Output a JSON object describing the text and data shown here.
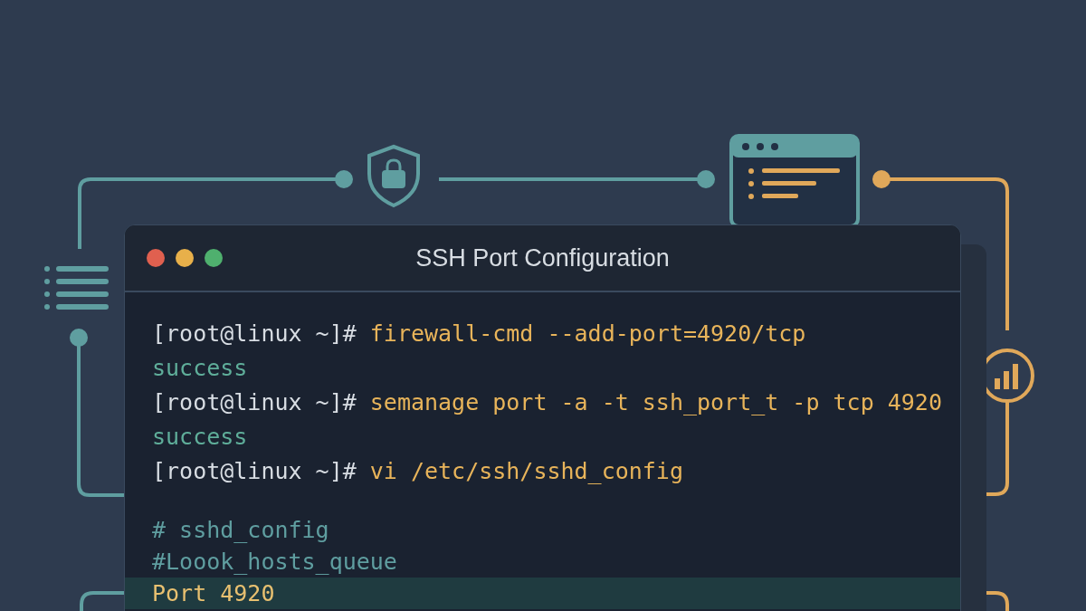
{
  "window": {
    "title": "SSH Port Configuration",
    "controls": [
      {
        "color": "#e0604f"
      },
      {
        "color": "#e8b04a"
      },
      {
        "color": "#4fb06e"
      }
    ]
  },
  "terminal": [
    {
      "kind": "command",
      "prompt": "[root@linux ~]#",
      "text": "firewall-cmd --add-port=4920/tcp"
    },
    {
      "kind": "output",
      "text": "success"
    },
    {
      "kind": "command",
      "prompt": "[root@linux ~]#",
      "text": "semanage port -a -t ssh_port_t -p tcp 4920"
    },
    {
      "kind": "output",
      "text": "success"
    },
    {
      "kind": "command",
      "prompt": "[root@linux ~]#",
      "text": "vi /etc/ssh/sshd_config"
    }
  ],
  "config_file": [
    {
      "text": "# sshd_config",
      "highlighted": false
    },
    {
      "text": "#Loook_hosts_queue",
      "highlighted": false
    },
    {
      "text": "Port 4920",
      "highlighted": true
    }
  ]
}
